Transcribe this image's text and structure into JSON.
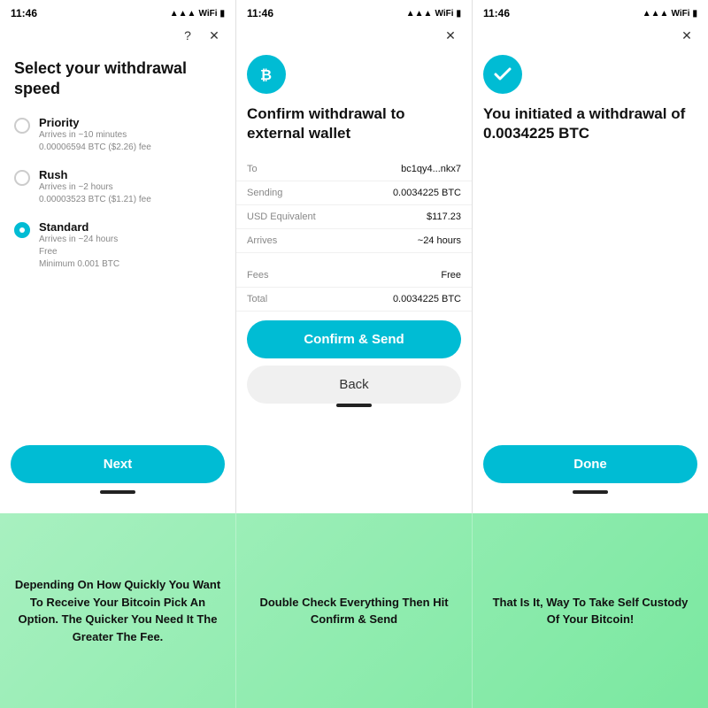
{
  "panels": [
    {
      "id": "withdrawal-speed",
      "statusTime": "11:46",
      "headerIcons": [
        "?",
        "×"
      ],
      "title": "Select your withdrawal speed",
      "options": [
        {
          "id": "priority",
          "label": "Priority",
          "sub1": "Arrives in ~10 minutes",
          "sub2": "0.00006594 BTC ($2.26) fee",
          "selected": false
        },
        {
          "id": "rush",
          "label": "Rush",
          "sub1": "Arrives in ~2 hours",
          "sub2": "0.00003523 BTC ($1.21) fee",
          "selected": false
        },
        {
          "id": "standard",
          "label": "Standard",
          "sub1": "Arrives in ~24 hours",
          "sub2": "Free",
          "sub3": "Minimum 0.001 BTC",
          "selected": true
        }
      ],
      "primaryButton": "Next",
      "caption": "Depending On How Quickly You Want To Receive Your Bitcoin Pick An Option. The Quicker You Need It The Greater The Fee."
    },
    {
      "id": "confirm-withdrawal",
      "statusTime": "11:46",
      "headerIcons": [
        "×"
      ],
      "iconType": "bitcoin",
      "title": "Confirm withdrawal to external wallet",
      "details": [
        {
          "label": "To",
          "value": "bc1qy4...nkx7"
        },
        {
          "label": "Sending",
          "value": "0.0034225 BTC"
        },
        {
          "label": "USD Equivalent",
          "value": "$117.23"
        },
        {
          "label": "Arrives",
          "value": "~24 hours"
        }
      ],
      "feeDetails": [
        {
          "label": "Fees",
          "value": "Free"
        },
        {
          "label": "Total",
          "value": "0.0034225 BTC"
        }
      ],
      "primaryButton": "Confirm & Send",
      "secondaryButton": "Back",
      "caption": "Double Check Everything Then Hit Confirm & Send"
    },
    {
      "id": "success",
      "statusTime": "11:46",
      "headerIcons": [
        "×"
      ],
      "iconType": "check",
      "title": "You initiated a withdrawal of 0.0034225 BTC",
      "primaryButton": "Done",
      "caption": "That Is It, Way To Take Self Custody Of Your Bitcoin!"
    }
  ]
}
